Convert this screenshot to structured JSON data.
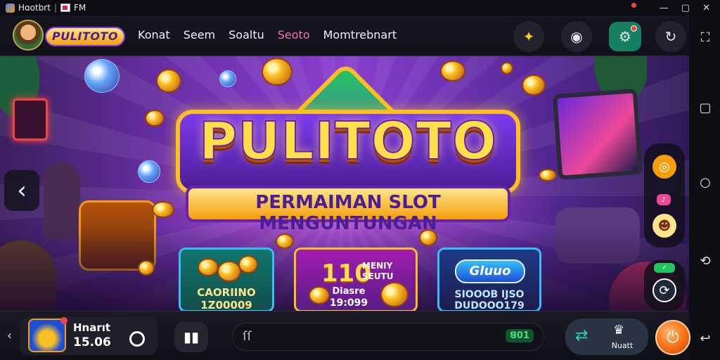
{
  "statusbar": {
    "app_name": "Hɑotbrt",
    "separator": "|",
    "fm_label": "FM",
    "window_controls": [
      "minimize",
      "restore",
      "close"
    ]
  },
  "header": {
    "logo_text": "PULITOTO",
    "nav": [
      "Konat",
      "Seem",
      "Soaltu",
      "Seoto",
      "Momtrebnart"
    ],
    "active_nav_index": 3,
    "buttons": [
      {
        "name": "star-icon"
      },
      {
        "name": "gamepad-icon"
      },
      {
        "name": "settings-icon",
        "has_badge": true
      },
      {
        "name": "share-icon"
      }
    ]
  },
  "banner": {
    "title": "PULITOTO",
    "subtitle": "PERMAIMAN SLOT MENGUNTUNGAN",
    "cards": [
      {
        "line1": "CAORIINO",
        "line2": "1Z00009"
      },
      {
        "big": "110",
        "tag1": "MENIY",
        "tag2": "SEUTU",
        "line1": "Diasre",
        "line2": "19:099"
      },
      {
        "logo": "Gluuo",
        "line1": "SIOOOB IJSO",
        "line2": "DUDOOO179"
      }
    ]
  },
  "bottombar": {
    "user": "Hnarıt",
    "time": "15.06",
    "input_text": "ſſ",
    "input_badge": "ꓭ01",
    "combo_label": "Nuatt"
  },
  "colors": {
    "accent_pink": "#f472b6",
    "settings_green": "#15805f",
    "power_orange": "#f97316"
  }
}
